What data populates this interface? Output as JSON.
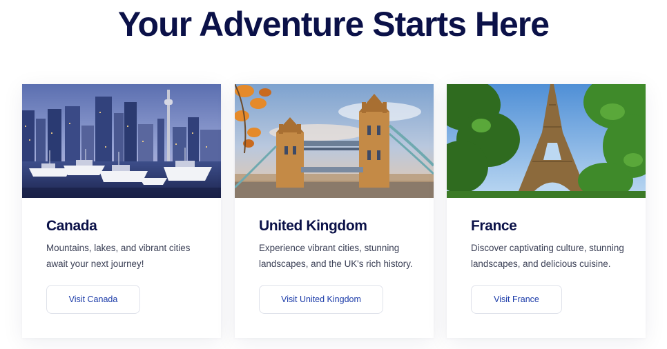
{
  "page": {
    "title": "Your Adventure Starts Here"
  },
  "destinations": [
    {
      "name": "Canada",
      "description": "Mountains, lakes, and vibrant cities await your next journey!",
      "button_label": "Visit Canada"
    },
    {
      "name": "United Kingdom",
      "description": "Experience vibrant cities, stunning landscapes, and the UK's rich history.",
      "button_label": "Visit United Kingdom"
    },
    {
      "name": "France",
      "description": "Discover captivating culture, stunning landscapes, and delicious cuisine.",
      "button_label": "Visit France"
    }
  ],
  "colors": {
    "title": "#0b1148",
    "button_text": "#1a3aa8",
    "button_border": "#dfe2ea",
    "body_text": "#3a3f55"
  }
}
